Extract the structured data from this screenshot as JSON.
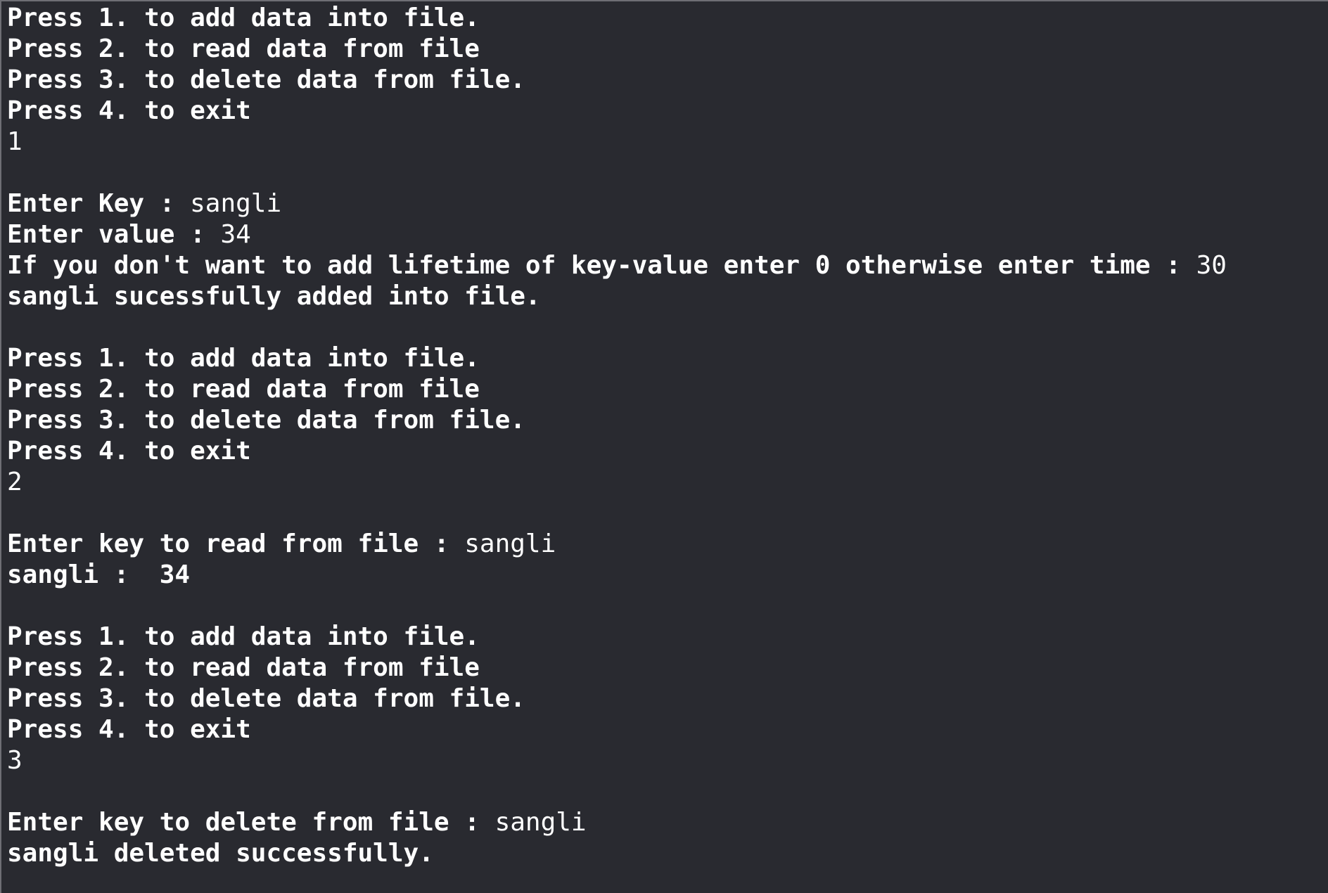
{
  "theme": {
    "background": "#292a30",
    "text": "#ffffff"
  },
  "menu": {
    "opt1": "Press 1. to add data into file.",
    "opt2": "Press 2. to read data from file",
    "opt3": "Press 3. to delete data from file.",
    "opt4": "Press 4. to exit"
  },
  "session": {
    "choice1": "1",
    "add_key_prompt": "Enter Key : ",
    "add_key_value": "sangli",
    "add_value_prompt": "Enter value : ",
    "add_value_value": "34",
    "lifetime_prompt": "If you don't want to add lifetime of key-value enter 0 otherwise enter time : ",
    "lifetime_value": "30",
    "add_result": "sangli sucessfully added into file.",
    "choice2": "2",
    "read_prompt": "Enter key to read from file : ",
    "read_value": "sangli",
    "read_result": "sangli :  34",
    "choice3": "3",
    "delete_prompt": "Enter key to delete from file : ",
    "delete_value": "sangli",
    "delete_result": "sangli deleted successfully."
  }
}
